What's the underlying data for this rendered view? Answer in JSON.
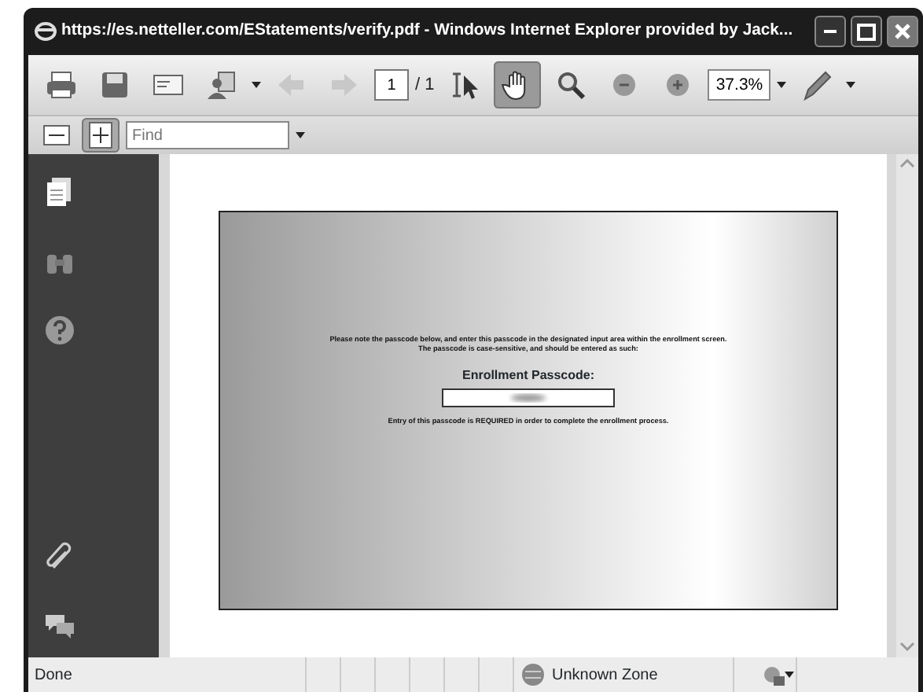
{
  "window": {
    "title": "https://es.netteller.com/EStatements/verify.pdf - Windows Internet Explorer provided by Jack..."
  },
  "toolbar": {
    "tools": [
      {
        "kind": "print",
        "selected": false
      },
      {
        "kind": "save",
        "selected": false
      },
      {
        "kind": "email",
        "selected": false
      },
      {
        "kind": "share",
        "selected": false
      },
      {
        "kind": "prev",
        "selected": false
      },
      {
        "kind": "next",
        "selected": false
      },
      {
        "kind": "page"
      },
      {
        "kind": "select",
        "selected": false
      },
      {
        "kind": "hand",
        "selected": true
      },
      {
        "kind": "zoomtool",
        "selected": false
      },
      {
        "kind": "zoomout",
        "selected": false
      },
      {
        "kind": "zoomin",
        "selected": false
      },
      {
        "kind": "zoom"
      },
      {
        "kind": "pen",
        "selected": false
      }
    ],
    "page_number": "1",
    "page_total": "/ 1",
    "zoom": "37.3%"
  },
  "toolbar2": {
    "tools": [
      {
        "kind": "fitwidth",
        "selected": false
      },
      {
        "kind": "fitpage",
        "selected": true
      }
    ],
    "find": {
      "placeholder": "Find"
    }
  },
  "sidebar": {
    "items": [
      {
        "kind": "pages"
      },
      {
        "kind": "find"
      },
      {
        "kind": "help"
      },
      {
        "kind": "attach"
      },
      {
        "kind": "comments"
      }
    ]
  },
  "document": {
    "instructions": "Please note the passcode below, and enter this passcode in the designated input area within the enrollment screen.",
    "instructions_2": "The passcode is case-sensitive, and should be entered as such:",
    "passcode_label": "Enrollment Passcode:",
    "note": "Entry of this passcode is REQUIRED in order to complete the enrollment process."
  },
  "status_bar": {
    "text": "Done",
    "zone": "Unknown Zone"
  }
}
